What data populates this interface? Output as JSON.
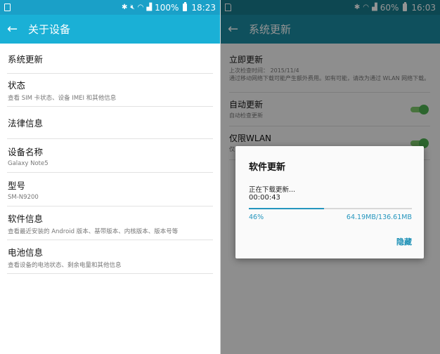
{
  "left": {
    "status": {
      "percent": "100%",
      "time": "18:23"
    },
    "appbar": {
      "title": "关于设备"
    },
    "items": [
      {
        "title": "系统更新",
        "sub": ""
      },
      {
        "title": "状态",
        "sub": "查看 SIM 卡状态、设备 IMEI 和其他信息"
      },
      {
        "title": "法律信息",
        "sub": ""
      },
      {
        "title": "设备名称",
        "sub": "Galaxy Note5"
      },
      {
        "title": "型号",
        "sub": "SM-N9200"
      },
      {
        "title": "软件信息",
        "sub": "查看最近安装的 Android 版本、基带版本、内核版本、版本号等"
      },
      {
        "title": "电池信息",
        "sub": "查看设备的电池状态、剩余电量和其他信息"
      }
    ]
  },
  "right": {
    "status": {
      "percent": "60%",
      "time": "16:03"
    },
    "appbar": {
      "title": "系统更新"
    },
    "items": [
      {
        "title": "立即更新",
        "sub": "上次检查时间： 2015/11/4",
        "sub2": "通过移动网络下载可能产生额外费用。如有可能，请改为通过 WLAN 网络下载。"
      },
      {
        "title": "自动更新",
        "sub": "自动检查更新",
        "toggle_on": true
      },
      {
        "title": "仅限WLAN",
        "sub": "仅",
        "toggle_on": true
      }
    ],
    "dialog": {
      "title": "软件更新",
      "message": "正在下载更新...",
      "elapsed": "00:00:43",
      "progress_fraction": 0.46,
      "percent_text": "46%",
      "size_text": "64.19MB/136.61MB",
      "hide_button": "隐藏"
    }
  },
  "colors": {
    "left_statusbar": "#1aa0c8",
    "left_appbar": "#1ab0d6",
    "right_statusbar": "#177a8c",
    "right_appbar": "#1a8aa0",
    "progress": "#2596be",
    "toggle": "#4caf50"
  }
}
